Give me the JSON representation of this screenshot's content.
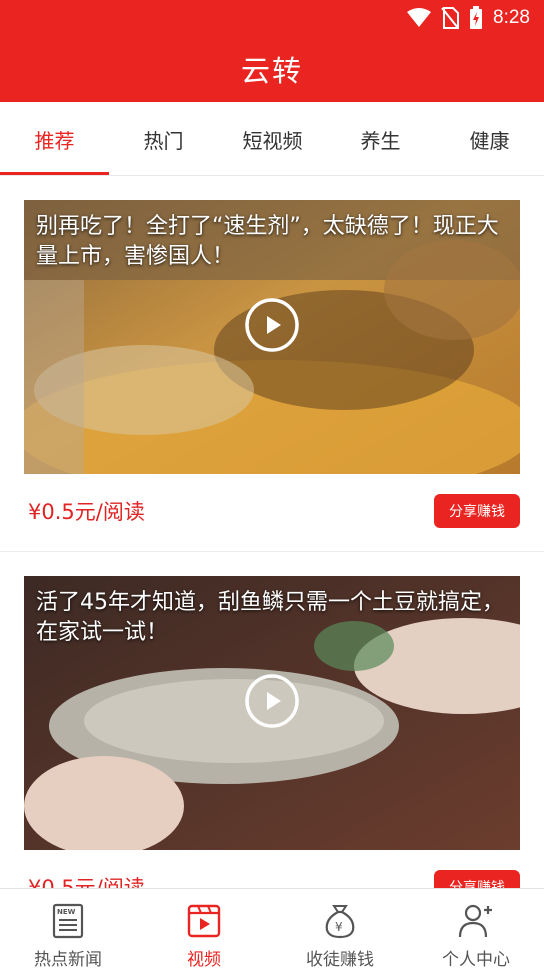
{
  "status_bar": {
    "time": "8:28",
    "icons": [
      "wifi-icon",
      "no-sim-icon",
      "battery-charging-icon"
    ]
  },
  "header": {
    "title": "云转"
  },
  "tabs": [
    {
      "label": "推荐",
      "active": true
    },
    {
      "label": "热门",
      "active": false
    },
    {
      "label": "短视频",
      "active": false
    },
    {
      "label": "养生",
      "active": false
    },
    {
      "label": "健康",
      "active": false
    }
  ],
  "feed": {
    "cards": [
      {
        "title": "别再吃了！全打了“速生剂”，太缺德了！现正大量上市，害惨国人！",
        "price": "¥0.5元/阅读",
        "share_label": "分享赚钱",
        "icon": "play-icon"
      },
      {
        "title": "活了45年才知道，刮鱼鳞只需一个土豆就搞定，在家试一试！",
        "price": "¥0.5元/阅读",
        "share_label": "分享赚钱",
        "icon": "play-icon"
      }
    ]
  },
  "bottom_nav": [
    {
      "label": "热点新闻",
      "icon": "news-icon",
      "active": false
    },
    {
      "label": "视频",
      "icon": "video-icon",
      "active": true
    },
    {
      "label": "收徒赚钱",
      "icon": "money-bag-icon",
      "active": false
    },
    {
      "label": "个人中心",
      "icon": "user-add-icon",
      "active": false
    }
  ],
  "colors": {
    "brand": "#ea2420",
    "price": "#e02424",
    "inactive_text": "#555555"
  }
}
